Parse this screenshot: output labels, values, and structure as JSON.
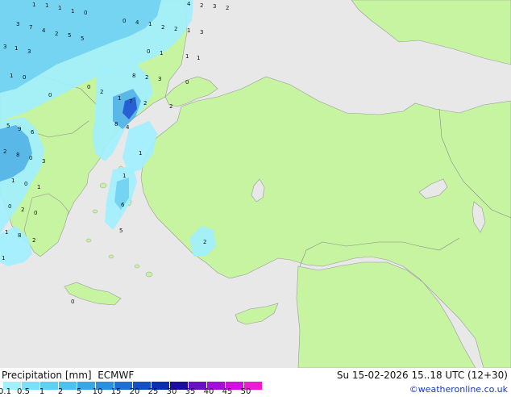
{
  "header": {
    "title": "Precipitation [mm]",
    "model": "ECMWF",
    "datetime": "Su 15-02-2026 15..18 UTC (12+30)"
  },
  "legend": {
    "ticks": [
      "0.1",
      "0.5",
      "1",
      "2",
      "5",
      "10",
      "15",
      "20",
      "25",
      "30",
      "35",
      "40",
      "45",
      "50"
    ],
    "colors": [
      "#a0f0ff",
      "#7ee0f8",
      "#5fd0f0",
      "#4ec2ee",
      "#3aa7e4",
      "#2a8fdc",
      "#1f6fd2",
      "#1450c4",
      "#0a2fb4",
      "#1a0da0",
      "#6a10c8",
      "#a010d8",
      "#d010e0",
      "#f01ad0"
    ]
  },
  "credit": "©weatheronline.co.uk",
  "colors": {
    "land": "#c6f4a0",
    "sea": "#e8e8e8",
    "border": "#8a8a8a"
  },
  "map_labels": [
    "1",
    "1",
    "1",
    "1",
    "0",
    "4",
    "2",
    "3",
    "2",
    "3",
    "7",
    "4",
    "2",
    "5",
    "5",
    "0",
    "4",
    "1",
    "2",
    "2",
    "1",
    "3",
    "3",
    "1",
    "3",
    "0",
    "1",
    "1",
    "1",
    "1",
    "0",
    "8",
    "2",
    "3",
    "0",
    "1",
    "7",
    "2",
    "2",
    "5",
    "9",
    "6",
    "8",
    "4",
    "2",
    "8",
    "0",
    "3",
    "1",
    "1",
    "0",
    "1",
    "1",
    "0",
    "2",
    "0",
    "6",
    "1",
    "8",
    "5",
    "2",
    "1",
    "2",
    "0",
    "0",
    "2",
    "0"
  ]
}
